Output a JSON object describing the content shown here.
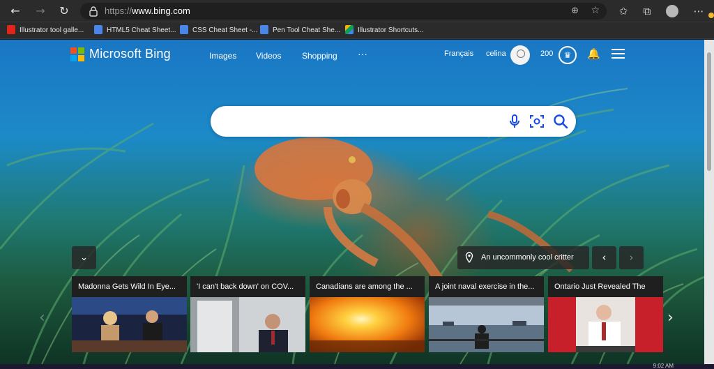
{
  "browser": {
    "url_prefix": "https://",
    "url_host": "www.bing.com",
    "icons": {
      "back": "arrow-left-icon",
      "forward": "arrow-right-icon",
      "refresh": "refresh-icon",
      "lock": "lock-icon",
      "zoom": "zoom-icon",
      "favorite": "star-add-icon",
      "favorites": "favorites-icon",
      "collections": "collections-icon",
      "more": "more-icon"
    }
  },
  "favorites": [
    {
      "label": "Illustrator tool galle...",
      "icon": "adobe-icon"
    },
    {
      "label": "HTML5 Cheat Sheet...",
      "icon": "doc-icon"
    },
    {
      "label": "CSS Cheat Sheet -...",
      "icon": "doc-icon"
    },
    {
      "label": "Pen Tool Cheat She...",
      "icon": "doc-icon"
    },
    {
      "label": "Illustrator Shortcuts...",
      "icon": "drive-icon"
    }
  ],
  "bing": {
    "logo_text": "Microsoft Bing",
    "nav": [
      "Images",
      "Videos",
      "Shopping",
      "···"
    ],
    "language": "Français",
    "user": "celina",
    "points": "200"
  },
  "search": {
    "placeholder": ""
  },
  "image_info": {
    "caption": "An uncommonly cool critter"
  },
  "cards": [
    {
      "title": "Madonna Gets Wild In Eye..."
    },
    {
      "title": "'I can't back down' on COV..."
    },
    {
      "title": "Canadians are among the ..."
    },
    {
      "title": "A joint naval exercise in the..."
    },
    {
      "title": "Ontario Just Revealed The"
    }
  ],
  "taskbar": {
    "clock": "9:02 AM"
  },
  "colors": {
    "ms_red": "#f25022",
    "ms_green": "#7fba00",
    "ms_blue": "#00a4ef",
    "ms_yellow": "#ffb900",
    "search_icon_blue": "#174ae4"
  }
}
